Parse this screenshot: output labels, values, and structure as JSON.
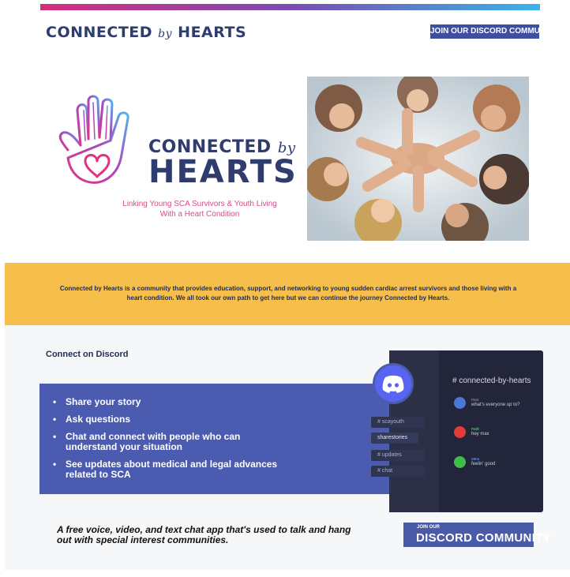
{
  "header": {
    "brand_word1": "CONNECTED",
    "brand_by": "by",
    "brand_word2": "HEARTS",
    "join_label": "JOIN OUR DISCORD COMMUNITY"
  },
  "hero": {
    "logo_line1": "CONNECTED",
    "logo_by": "by",
    "logo_line2": "HEARTS",
    "tagline": "Linking Young SCA Survivors & Youth Living With a Heart Condition",
    "photo_icon": "group-hands-photo-icon"
  },
  "mission": {
    "text": "Connected by Hearts is a community that provides education, support, and networking to young sudden cardiac arrest survivors and those living with a heart condition. We all took our own path to get here but we can continue the journey Connected by Hearts."
  },
  "discord_section": {
    "title": "Connect on Discord",
    "features": [
      "Share your story",
      "Ask questions",
      "Chat and connect with people who can understand your situation",
      "See updates about medical and legal advances related to SCA"
    ],
    "channel_header": "# connected-by-hearts",
    "channels": [
      "# scayouth",
      "sharestories",
      "# updates",
      "# chat"
    ],
    "messages": [
      {
        "name": "max",
        "text": "what's everyone up to?",
        "color": "#4a78d8"
      },
      {
        "name": "matt",
        "text": "hey max",
        "color": "#e53a3a"
      },
      {
        "name": "sara",
        "text": "feelin' good",
        "color": "#3fbf4a"
      }
    ],
    "promo_text": "A free voice, video, and text chat app that's used to talk and hang out with special interest communities.",
    "button_small": "JOIN OUR",
    "button_big": "DISCORD COMMUNITY",
    "badge_icon": "discord-logo-icon"
  },
  "colors": {
    "accent": "#3e4fa0",
    "yellow": "#f6bf4b",
    "pink": "#d62d7c",
    "cyan": "#3bb3e8"
  }
}
